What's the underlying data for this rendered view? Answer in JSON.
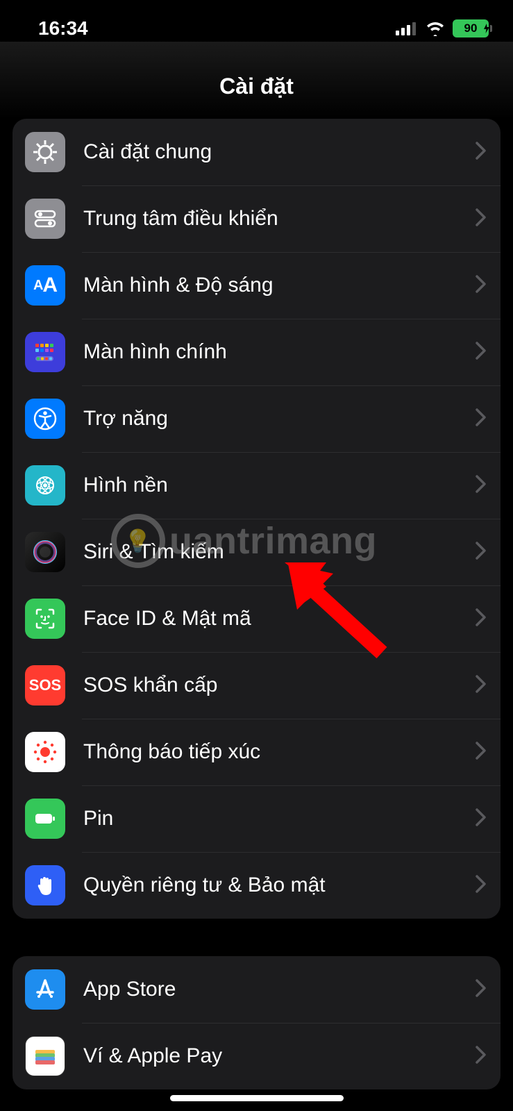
{
  "status": {
    "time": "16:34",
    "battery": "90"
  },
  "header": {
    "title": "Cài đặt"
  },
  "group1": {
    "items": [
      {
        "label": "Cài đặt chung"
      },
      {
        "label": "Trung tâm điều khiển"
      },
      {
        "label": "Màn hình & Độ sáng"
      },
      {
        "label": "Màn hình chính"
      },
      {
        "label": "Trợ năng"
      },
      {
        "label": "Hình nền"
      },
      {
        "label": "Siri & Tìm kiếm"
      },
      {
        "label": "Face ID & Mật mã"
      },
      {
        "label": "SOS khẩn cấp"
      },
      {
        "label": "Thông báo tiếp xúc"
      },
      {
        "label": "Pin"
      },
      {
        "label": "Quyền riêng tư & Bảo mật"
      }
    ]
  },
  "group2": {
    "items": [
      {
        "label": "App Store"
      },
      {
        "label": "Ví & Apple Pay"
      }
    ]
  },
  "watermark": {
    "text": "uantrimang"
  }
}
